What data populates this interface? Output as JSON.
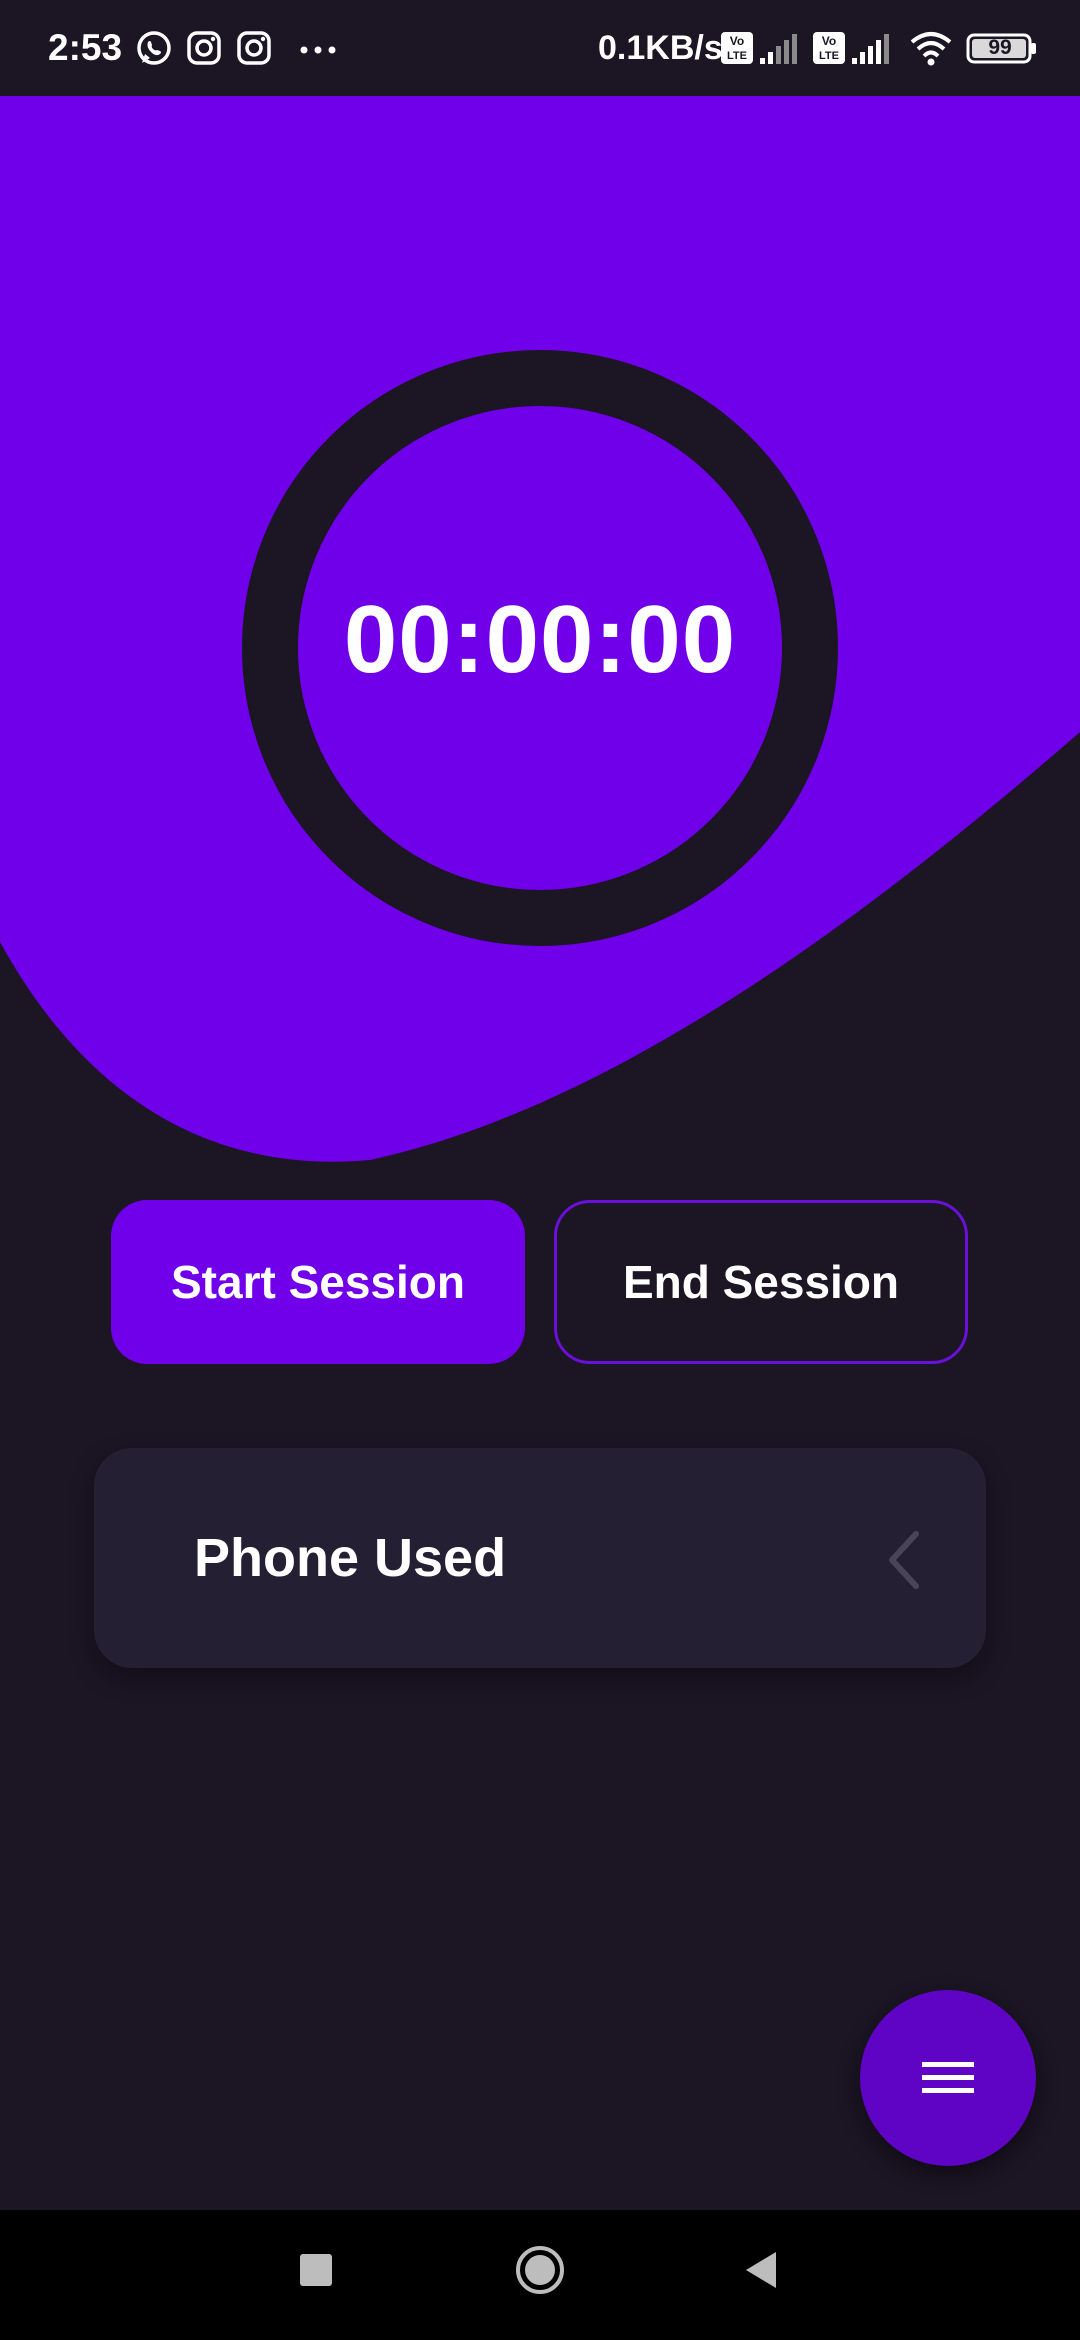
{
  "status_bar": {
    "time": "2:53",
    "notification_icons": [
      "whatsapp-icon",
      "instagram-icon",
      "instagram-icon",
      "more-dots-icon"
    ],
    "network_speed": "0.1KB/s",
    "sim_badges": [
      "Vo LTE",
      "Vo LTE"
    ],
    "battery": "99"
  },
  "timer": {
    "display": "00:00:00"
  },
  "actions": {
    "start_label": "Start Session",
    "end_label": "End Session"
  },
  "card": {
    "label": "Phone Used",
    "icon": "chevron-left-icon"
  },
  "fab": {
    "icon": "menu-icon"
  },
  "nav": {
    "icons": [
      "recents-square-icon",
      "home-circle-icon",
      "back-triangle-icon"
    ]
  },
  "colors": {
    "accent": "#7000ea",
    "background": "#1b1524",
    "card": "#251f33",
    "fab": "#5f04c4"
  }
}
